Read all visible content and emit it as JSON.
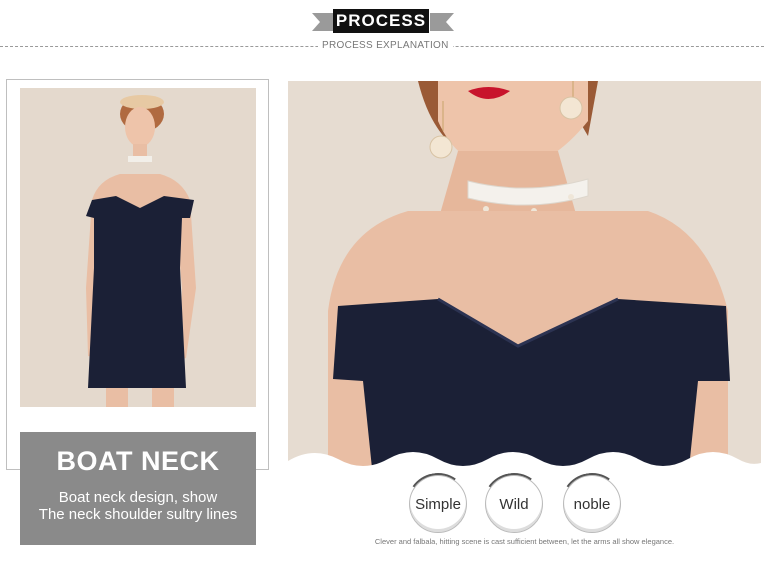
{
  "header": {
    "title": "PROCESS",
    "subtitle": "PROCESS EXPLANATION"
  },
  "feature": {
    "heading": "BOAT NECK",
    "desc_line1": "Boat neck design, show",
    "desc_line2": "The neck shoulder sultry lines"
  },
  "badges": [
    "Simple",
    "Wild",
    "noble"
  ],
  "caption": "Clever and falbala, hitting scene is cast sufficient between, let the arms all show elegance.",
  "colors": {
    "dress": "#1b2036",
    "background_photo": "#e6dcd1",
    "skin": "#e9bea4",
    "label_box": "#8a8a8a"
  }
}
